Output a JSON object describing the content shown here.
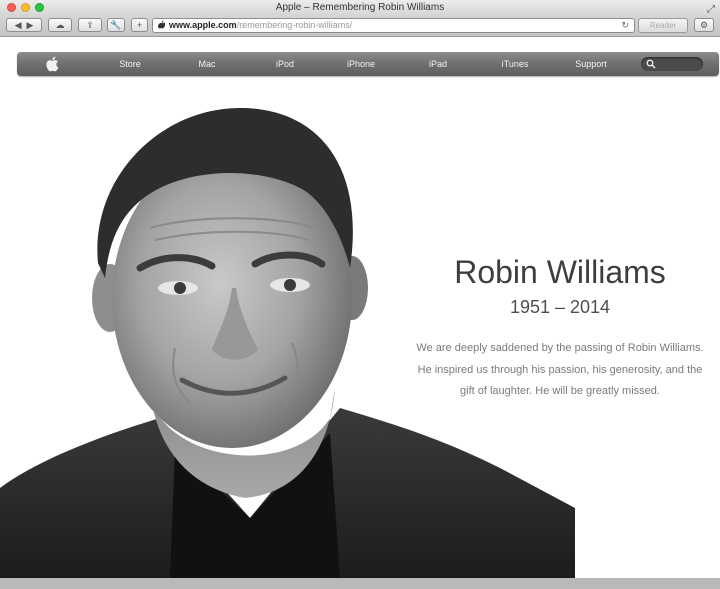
{
  "window": {
    "title": "Apple – Remembering Robin Williams"
  },
  "toolbar": {
    "url_host": "www.apple.com",
    "url_path": "/remembering-robin-williams/",
    "reader_label": "Reader"
  },
  "nav": {
    "items": [
      "Store",
      "Mac",
      "iPod",
      "iPhone",
      "iPad",
      "iTunes",
      "Support"
    ]
  },
  "hero": {
    "name": "Robin Williams",
    "years": "1951 – 2014",
    "tribute_line1": "We are deeply saddened by the passing of Robin Williams.",
    "tribute_line2": "He inspired us through his passion, his generosity, and the",
    "tribute_line3": "gift of laughter. He will be greatly missed."
  },
  "colors": {
    "nav_bar": "#6f6f6f",
    "page_background": "#ffffff",
    "heading_text": "#3e3e3e",
    "body_text": "#7a7a7a"
  }
}
